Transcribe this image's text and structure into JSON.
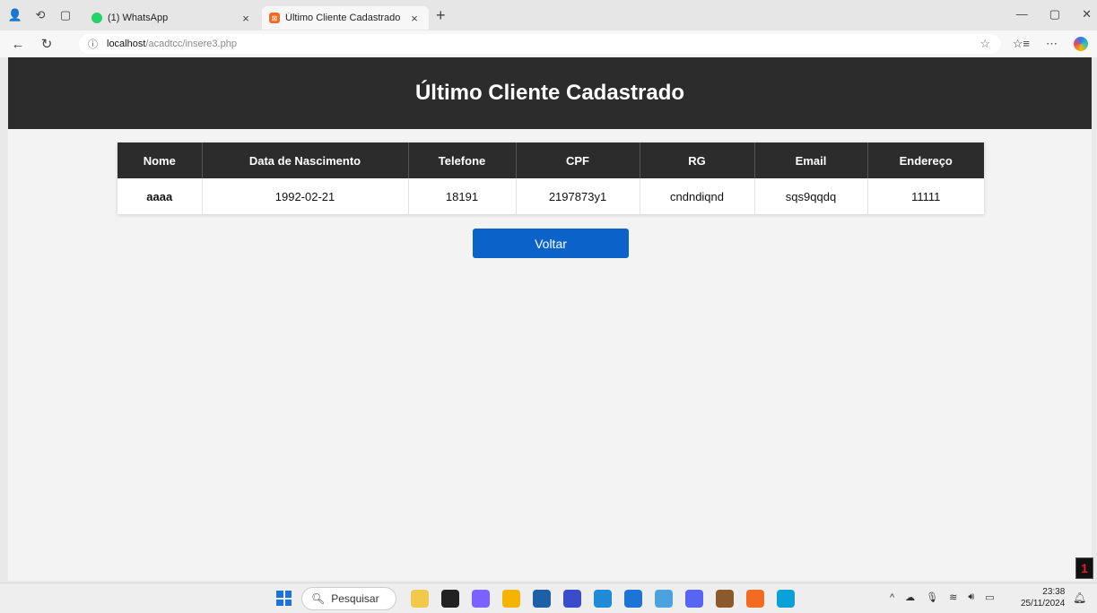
{
  "browser": {
    "tabs": [
      {
        "title": "(1) WhatsApp",
        "favicon_color": "#25d366",
        "active": false
      },
      {
        "title": "Último Cliente Cadastrado",
        "favicon_color": "#f26b21",
        "active": true
      }
    ],
    "new_tab_label": "+",
    "url_host": "localhost",
    "url_path": "/acadtcc/insere3.php"
  },
  "page": {
    "title": "Último Cliente Cadastrado",
    "table": {
      "headers": [
        "Nome",
        "Data de Nascimento",
        "Telefone",
        "CPF",
        "RG",
        "Email",
        "Endereço"
      ],
      "rows": [
        [
          "aaaa",
          "1992-02-21",
          "18191",
          "2197873y1",
          "cndndiqnd",
          "sqs9qqdq",
          "11111"
        ]
      ]
    },
    "back_button_label": "Voltar",
    "colors": {
      "header_bg": "#2c2c2c",
      "button_bg": "#0b63c9",
      "page_bg": "#f3f3f3"
    }
  },
  "taskbar": {
    "search_placeholder": "Pesquisar",
    "time": "23:38",
    "date": "25/11/2024",
    "notification_count": "1",
    "app_colors": [
      "#f2c94c",
      "#222222",
      "#7b61ff",
      "#f5b400",
      "#1e5fa8",
      "#3b4cca",
      "#1f8ad6",
      "#1e74d6",
      "#4aa3df",
      "#5865f2",
      "#8b5a2b",
      "#f26b21",
      "#0aa0d8"
    ]
  }
}
